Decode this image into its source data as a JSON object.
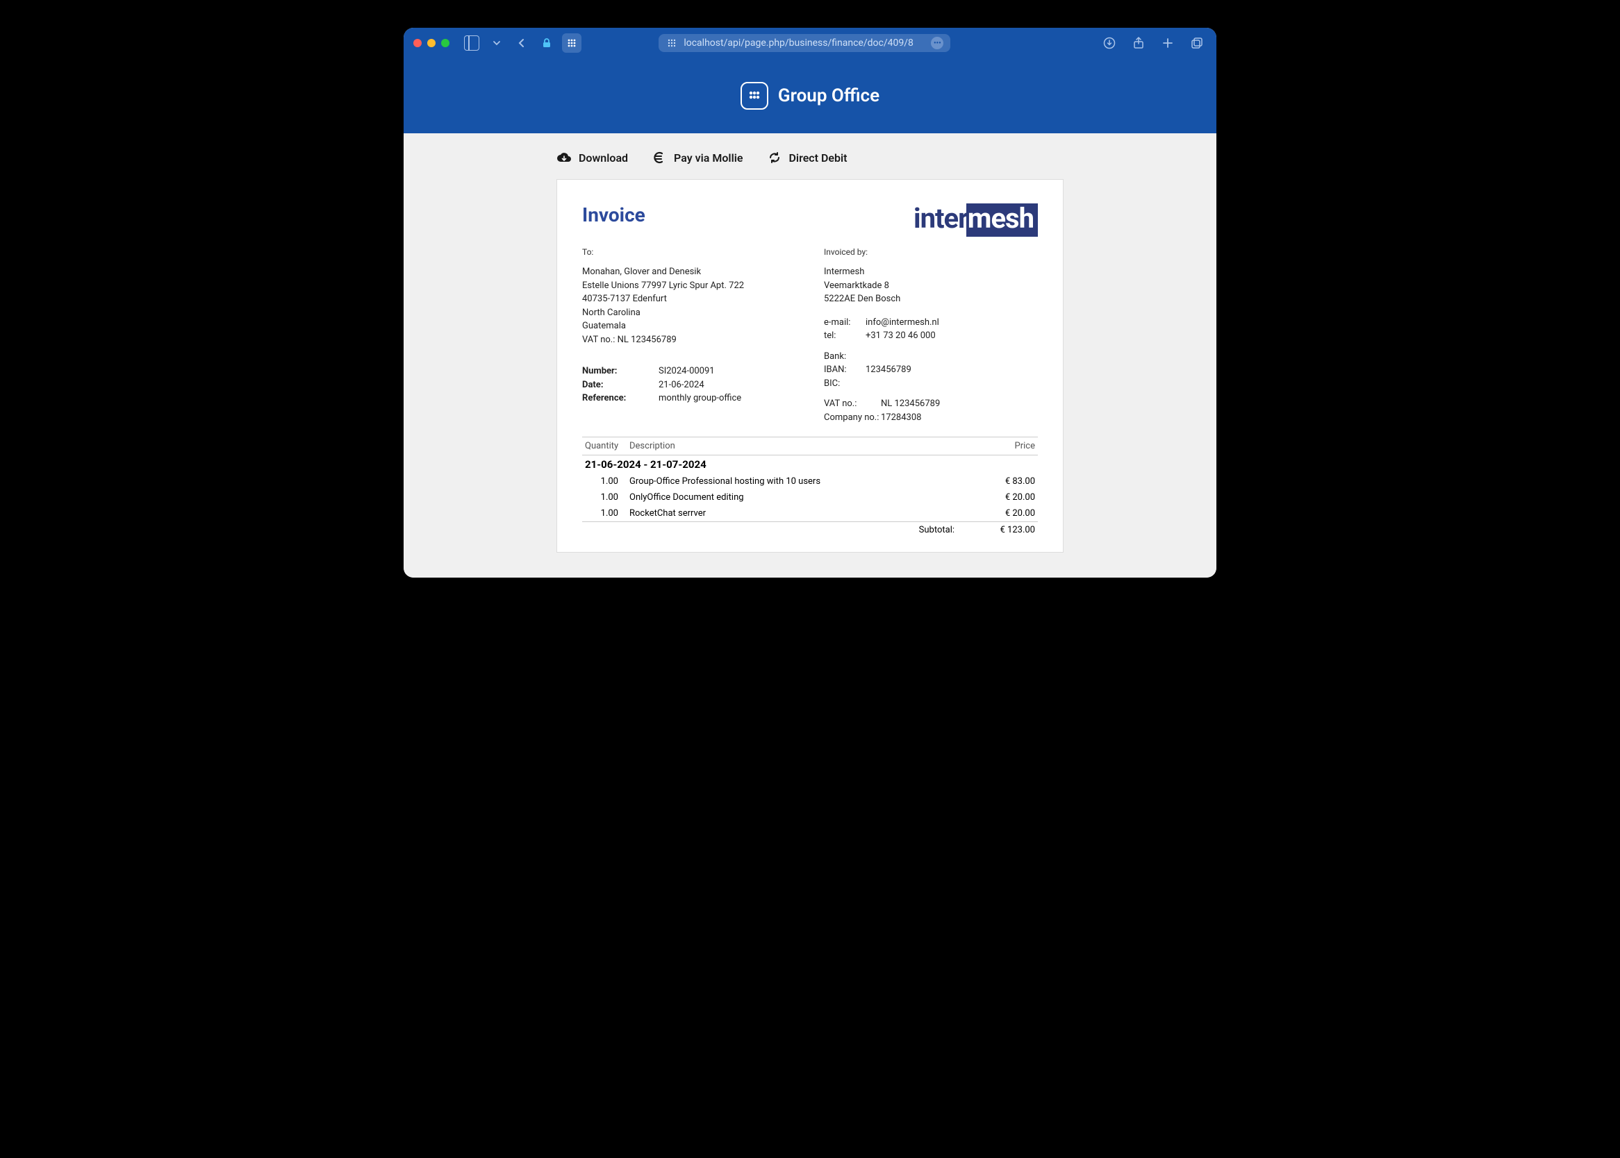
{
  "browser": {
    "url": "localhost/api/page.php/business/finance/doc/409/8"
  },
  "header": {
    "app_title": "Group Office"
  },
  "toolbar": {
    "download": "Download",
    "pay": "Pay via Mollie",
    "direct_debit": "Direct Debit"
  },
  "invoice": {
    "title": "Invoice",
    "to_label": "To:",
    "to_address": "Monahan, Glover and Denesik\nEstelle Unions 77997 Lyric Spur Apt. 722\n40735-7137 Edenfurt\nNorth Carolina\nGuatemala\nVAT no.: NL 123456789",
    "invoiced_by_label": "Invoiced by:",
    "from_address": "Intermesh\nVeemarktkade 8\n5222AE Den Bosch",
    "meta": {
      "number_label": "Number:",
      "number": "SI2024-00091",
      "date_label": "Date:",
      "date": "21-06-2024",
      "reference_label": "Reference:",
      "reference": "monthly group-office"
    },
    "contact": {
      "email_label": "e-mail:",
      "email": "info@intermesh.nl",
      "tel_label": "tel:",
      "tel": "+31 73 20 46 000",
      "bank_label": "Bank:",
      "iban_label": "IBAN:",
      "iban": "123456789",
      "bic_label": "BIC:",
      "vat_label": "VAT no.:",
      "vat": "NL 123456789",
      "company_label": "Company no.:",
      "company": "17284308"
    },
    "cols": {
      "qty": "Quantity",
      "desc": "Description",
      "price": "Price"
    },
    "period": "21-06-2024 - 21-07-2024",
    "lines": [
      {
        "qty": "1.00",
        "desc": "Group-Office Professional hosting with 10 users",
        "price": "€ 83.00"
      },
      {
        "qty": "1.00",
        "desc": "OnlyOffice Document editing",
        "price": "€ 20.00"
      },
      {
        "qty": "1.00",
        "desc": "RocketChat serrver",
        "price": "€ 20.00"
      }
    ],
    "subtotal_label": "Subtotal:",
    "subtotal": "€ 123.00",
    "vendor_logo": {
      "p1": "inter",
      "p2": "mesh"
    }
  }
}
